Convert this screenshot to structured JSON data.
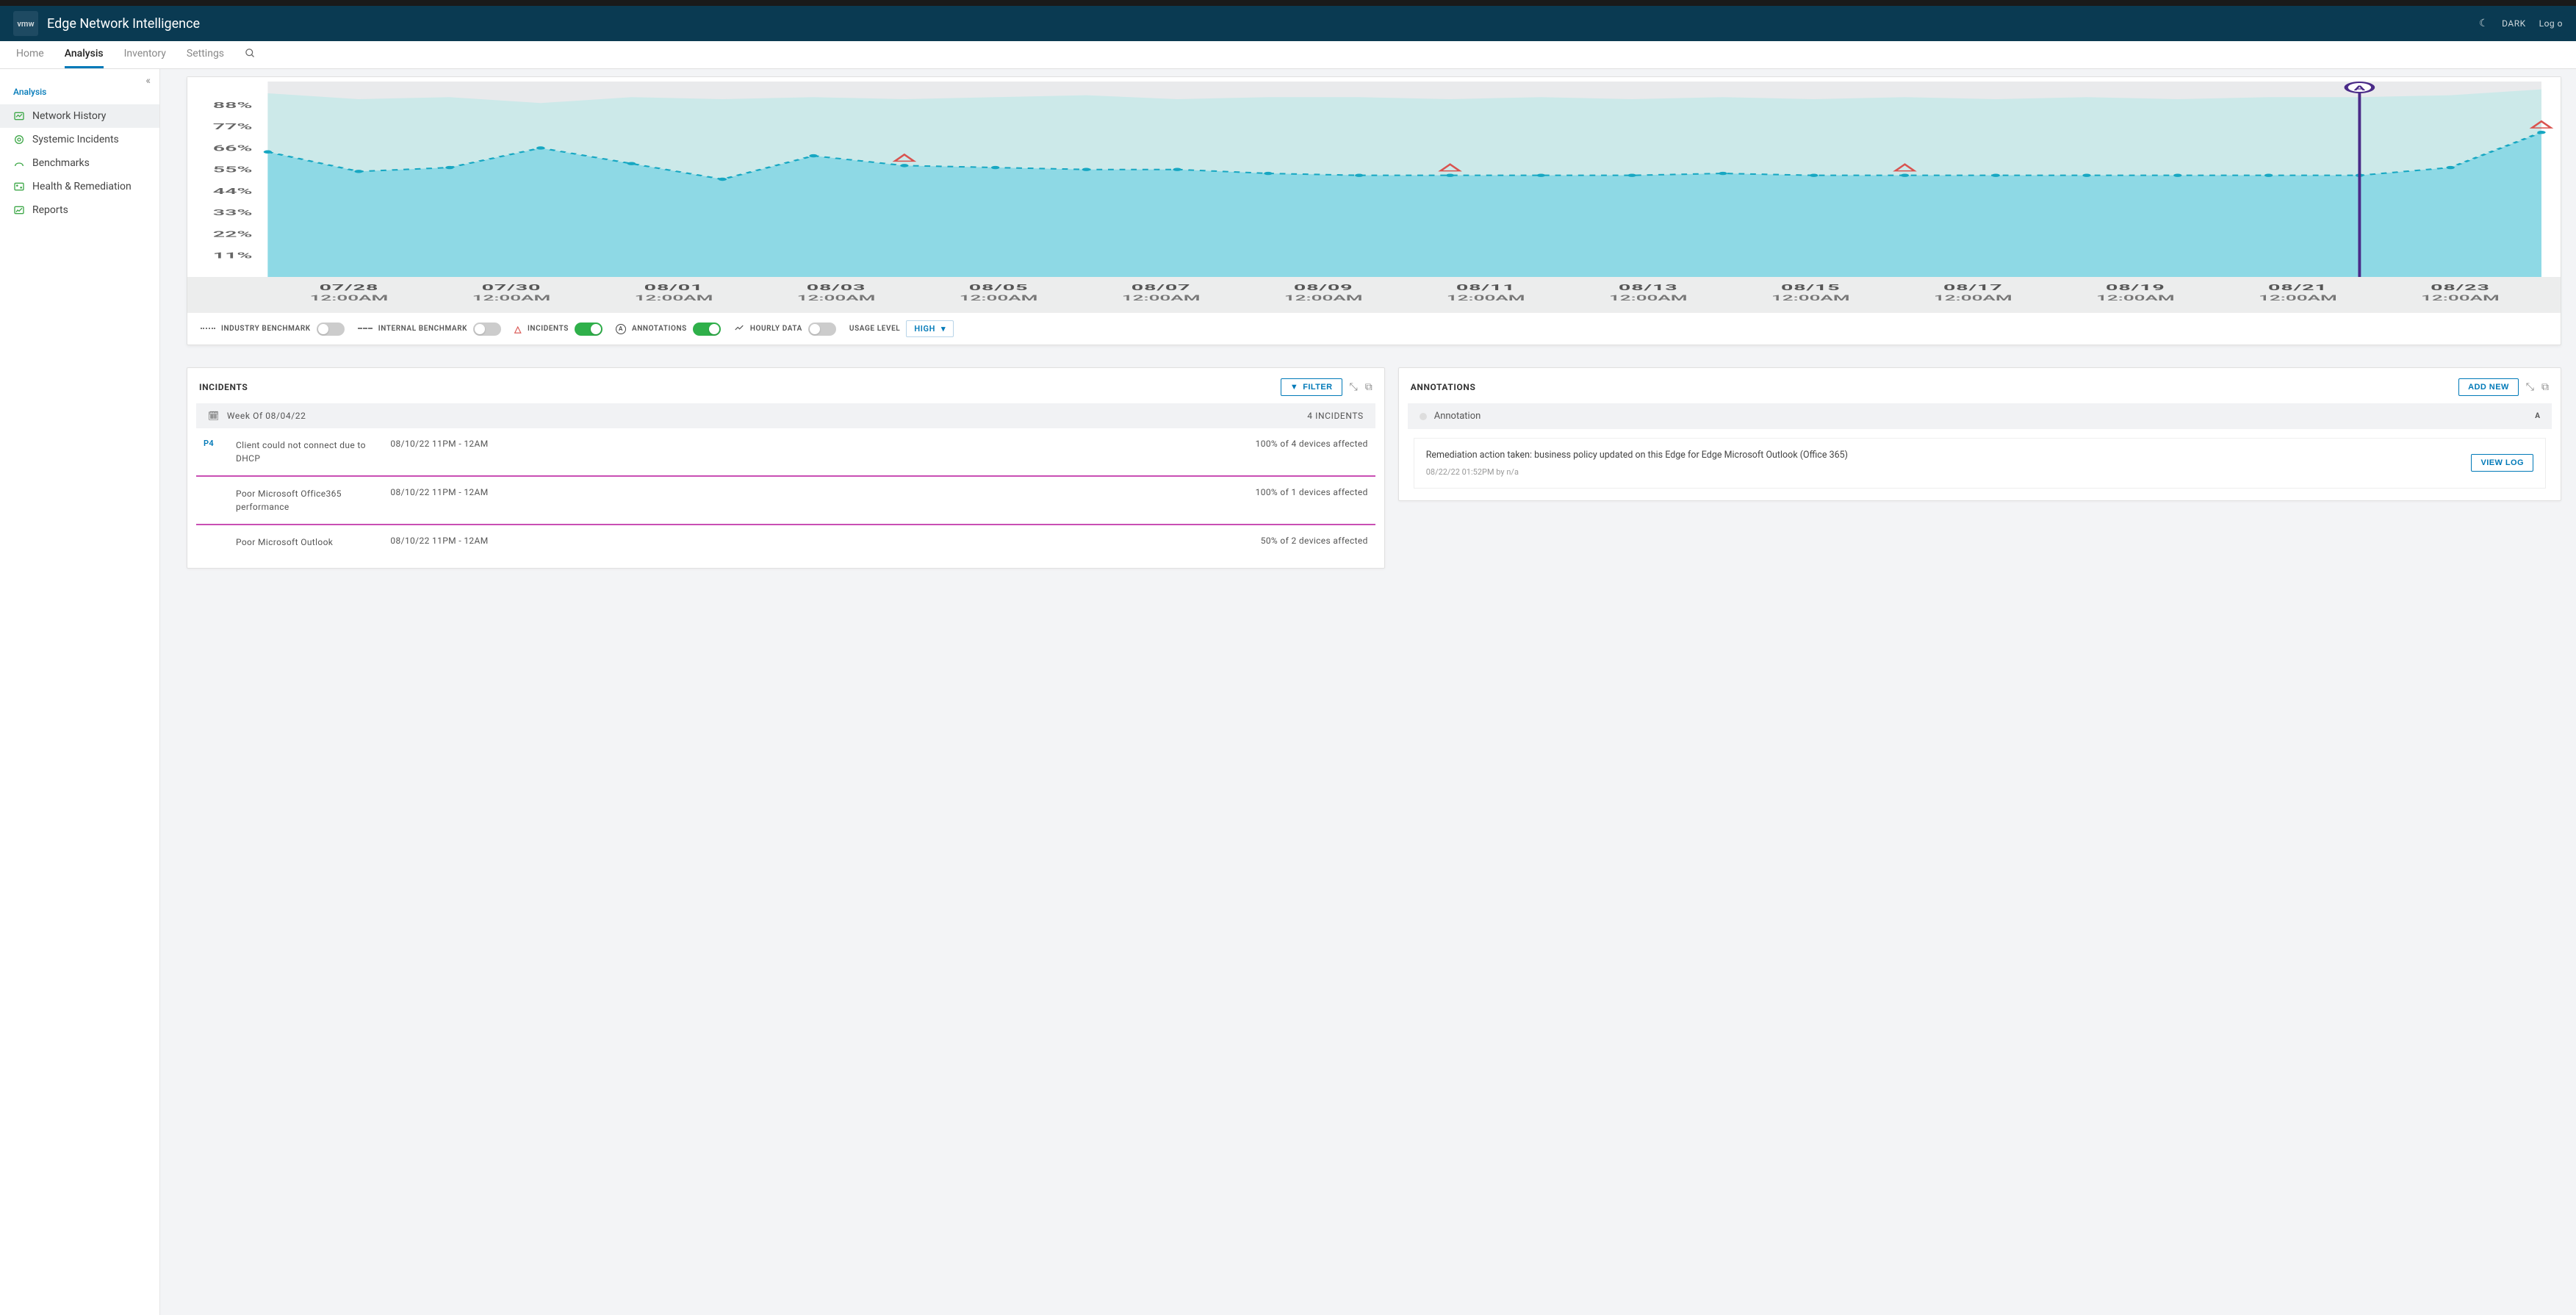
{
  "header": {
    "logo_text": "vmw",
    "app_title": "Edge Network Intelligence",
    "dark_label": "DARK",
    "logout_label": "Log o"
  },
  "nav": {
    "items": [
      "Home",
      "Analysis",
      "Inventory",
      "Settings"
    ],
    "active_index": 1
  },
  "sidebar": {
    "heading": "Analysis",
    "items": [
      {
        "label": "Network History",
        "icon": "history-icon",
        "active": true
      },
      {
        "label": "Systemic Incidents",
        "icon": "incidents-icon",
        "active": false
      },
      {
        "label": "Benchmarks",
        "icon": "benchmarks-icon",
        "active": false
      },
      {
        "label": "Health & Remediation",
        "icon": "health-icon",
        "active": false
      },
      {
        "label": "Reports",
        "icon": "reports-icon",
        "active": false
      }
    ]
  },
  "chart_data": {
    "type": "area",
    "ylabel": "%",
    "ylim": [
      0,
      88
    ],
    "y_ticks": [
      "88%",
      "77%",
      "66%",
      "55%",
      "44%",
      "33%",
      "22%",
      "11%"
    ],
    "x_ticks": [
      {
        "d": "07/28",
        "t": "12:00AM"
      },
      {
        "d": "07/30",
        "t": "12:00AM"
      },
      {
        "d": "08/01",
        "t": "12:00AM"
      },
      {
        "d": "08/03",
        "t": "12:00AM"
      },
      {
        "d": "08/05",
        "t": "12:00AM"
      },
      {
        "d": "08/07",
        "t": "12:00AM"
      },
      {
        "d": "08/09",
        "t": "12:00AM"
      },
      {
        "d": "08/11",
        "t": "12:00AM"
      },
      {
        "d": "08/13",
        "t": "12:00AM"
      },
      {
        "d": "08/15",
        "t": "12:00AM"
      },
      {
        "d": "08/17",
        "t": "12:00AM"
      },
      {
        "d": "08/19",
        "t": "12:00AM"
      },
      {
        "d": "08/21",
        "t": "12:00AM"
      },
      {
        "d": "08/23",
        "t": "12:00AM"
      }
    ],
    "series": [
      {
        "name": "value",
        "values": [
          64,
          54,
          56,
          66,
          58,
          50,
          62,
          57,
          56,
          55,
          55,
          53,
          52,
          52,
          52,
          52,
          53,
          52,
          52,
          52,
          52,
          52,
          52,
          52,
          56,
          74
        ]
      }
    ],
    "background_values": [
      94,
      91,
      92,
      89,
      92,
      91,
      92,
      91,
      92,
      93,
      91,
      92,
      92,
      91,
      92,
      91,
      92,
      91,
      92,
      91,
      92,
      91,
      92,
      92,
      93,
      96
    ],
    "markers": {
      "incidents_x_indices": [
        7,
        13,
        18,
        25
      ],
      "annotation_x_index": 23
    }
  },
  "chart_footer": {
    "industry_benchmark": "INDUSTRY BENCHMARK",
    "industry_on": false,
    "internal_benchmark": "INTERNAL BENCHMARK",
    "internal_on": false,
    "incidents": "INCIDENTS",
    "incidents_on": true,
    "annotations": "ANNOTATIONS",
    "annotations_on": true,
    "hourly_data": "HOURLY DATA",
    "hourly_on": false,
    "usage_level_label": "USAGE LEVEL",
    "usage_level_value": "HIGH"
  },
  "incidents_panel": {
    "title": "INCIDENTS",
    "filter_label": "FILTER",
    "group_label": "Week Of 08/04/22",
    "group_count": "4 INCIDENTS",
    "rows": [
      {
        "priority": "P4",
        "desc": "Client could not connect due to DHCP",
        "time": "08/10/22 11PM - 12AM",
        "affected": "100% of 4 devices affected"
      },
      {
        "priority": "",
        "desc": "Poor Microsoft Office365 performance",
        "time": "08/10/22 11PM - 12AM",
        "affected": "100% of 1 devices affected"
      },
      {
        "priority": "",
        "desc": "Poor Microsoft Outlook",
        "time": "08/10/22 11PM - 12AM",
        "affected": "50% of 2 devices affected"
      }
    ]
  },
  "annotations_panel": {
    "title": "ANNOTATIONS",
    "add_new_label": "ADD NEW",
    "group_label": "Annotation",
    "badge": "A",
    "card": {
      "text": "Remediation action taken: business policy updated on this Edge for Edge Microsoft Outlook (Office 365)",
      "meta": "08/22/22 01:52PM by n/a",
      "view_log": "VIEW LOG"
    }
  }
}
